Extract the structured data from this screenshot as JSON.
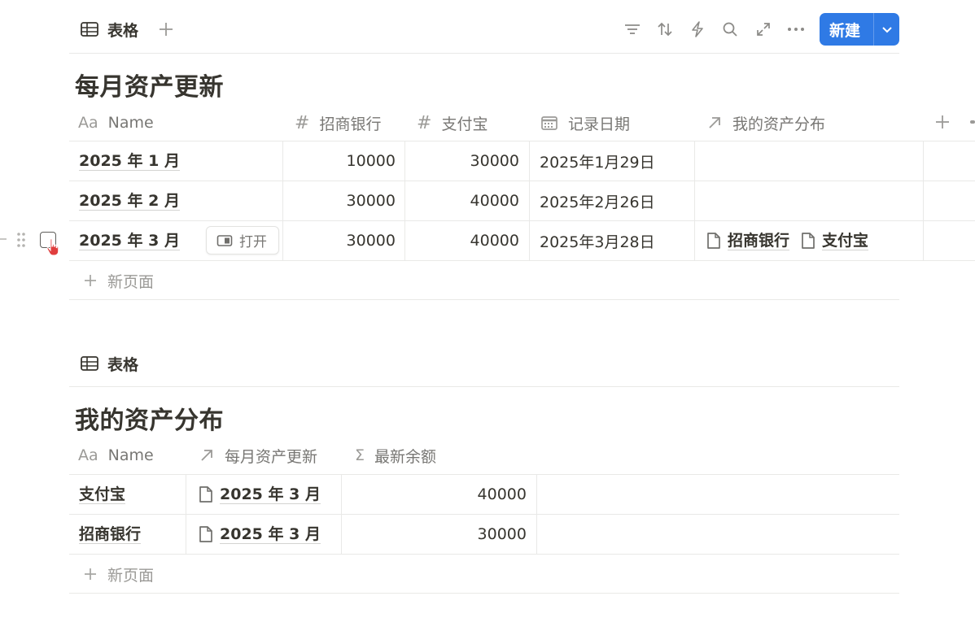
{
  "view1": {
    "tab_label": "表格",
    "new_button_label": "新建",
    "title": "每月资产更新",
    "columns": [
      {
        "icon": "Aa",
        "label": "Name"
      },
      {
        "icon": "#",
        "label": "招商银行"
      },
      {
        "icon": "#",
        "label": "支付宝"
      },
      {
        "icon": "calendar-icon",
        "label": "记录日期"
      },
      {
        "icon": "arrow-up-right-icon",
        "label": "我的资产分布"
      }
    ],
    "rows": [
      {
        "name": "2025 年 1 月",
        "cmb": "10000",
        "alipay": "30000",
        "date": "2025年1月29日",
        "relations": []
      },
      {
        "name": "2025 年 2 月",
        "cmb": "30000",
        "alipay": "40000",
        "date": "2025年2月26日",
        "relations": []
      },
      {
        "name": "2025 年 3 月",
        "cmb": "30000",
        "alipay": "40000",
        "date": "2025年3月28日",
        "relations": [
          "招商银行",
          "支付宝"
        ]
      }
    ],
    "open_label": "打开",
    "new_page_label": "新页面"
  },
  "view2": {
    "tab_label": "表格",
    "title": "我的资产分布",
    "columns": [
      {
        "icon": "Aa",
        "label": "Name"
      },
      {
        "icon": "arrow-up-right-icon",
        "label": "每月资产更新"
      },
      {
        "icon": "Σ",
        "label": "最新余额"
      }
    ],
    "rows": [
      {
        "name": "支付宝",
        "relation": "2025 年 3 月",
        "balance": "40000"
      },
      {
        "name": "招商银行",
        "relation": "2025 年 3 月",
        "balance": "30000"
      }
    ],
    "new_page_label": "新页面"
  },
  "colors": {
    "accent": "#2f7ae5",
    "cursor": "#e03e3e"
  }
}
